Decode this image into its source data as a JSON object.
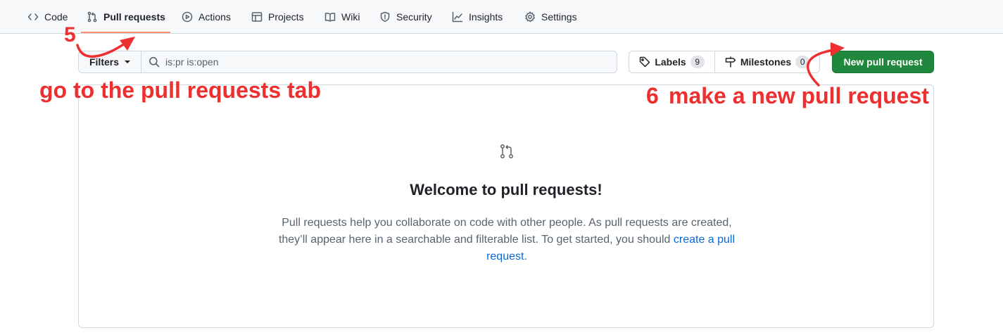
{
  "nav": {
    "tabs": [
      {
        "label": "Code",
        "icon": "code-icon"
      },
      {
        "label": "Pull requests",
        "icon": "git-pull-request-icon",
        "active": true
      },
      {
        "label": "Actions",
        "icon": "play-icon"
      },
      {
        "label": "Projects",
        "icon": "table-icon"
      },
      {
        "label": "Wiki",
        "icon": "book-icon"
      },
      {
        "label": "Security",
        "icon": "shield-icon"
      },
      {
        "label": "Insights",
        "icon": "graph-icon"
      },
      {
        "label": "Settings",
        "icon": "gear-icon"
      }
    ]
  },
  "toolbar": {
    "filters_label": "Filters",
    "search_value": "is:pr is:open",
    "labels_label": "Labels",
    "labels_count": "9",
    "milestones_label": "Milestones",
    "milestones_count": "0",
    "new_pr_label": "New pull request"
  },
  "blankslate": {
    "title": "Welcome to pull requests!",
    "text": "Pull requests help you collaborate on code with other people. As pull requests are created, they’ll appear here in a searchable and filterable list. To get started, you should ",
    "link": "create a pull request",
    "end": "."
  },
  "annotations": {
    "step5_number": "5",
    "step5_text": "go to the pull requests tab",
    "step6_number": "6",
    "step6_text": "make a new pull request"
  },
  "colors": {
    "accent_green": "#1f883d",
    "link_blue": "#0969da",
    "annotation_red": "#ee2f2f",
    "tab_underline": "#fd8c73"
  }
}
